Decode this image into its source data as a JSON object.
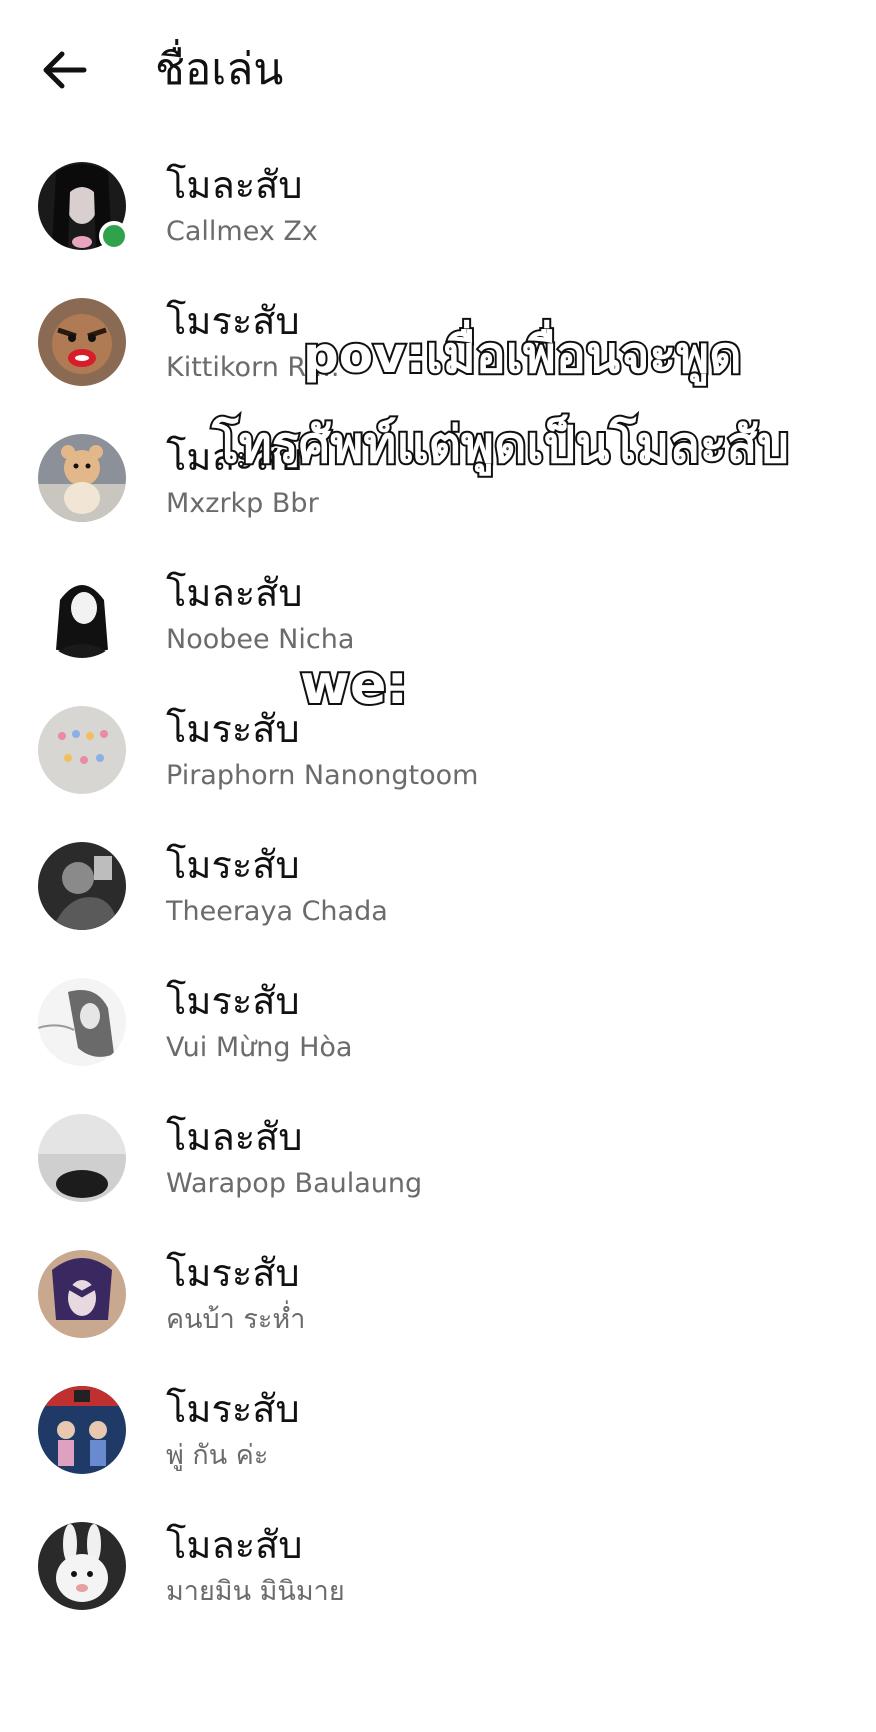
{
  "header": {
    "back_icon": "arrow-left-icon",
    "title": "ชื่อเล่น"
  },
  "members": [
    {
      "nickname": "โมละสับ",
      "name": "Callmex Zx",
      "online": true,
      "avatar": "dark-hair-girl"
    },
    {
      "nickname": "โมระสับ",
      "name": "Kittikorn Ri...",
      "online": false,
      "avatar": "monkey-face"
    },
    {
      "nickname": "โมละสับ",
      "name": "Mxzrkp Bbr",
      "online": false,
      "avatar": "teddy-bear"
    },
    {
      "nickname": "โมละสับ",
      "name": "Noobee Nicha",
      "online": false,
      "avatar": "anime-black-hair"
    },
    {
      "nickname": "โมระสับ",
      "name": "Piraphorn Nanongtoom",
      "online": false,
      "avatar": "figurines"
    },
    {
      "nickname": "โมระสับ",
      "name": "Theeraya Chada",
      "online": false,
      "avatar": "grey-photo"
    },
    {
      "nickname": "โมระสับ",
      "name": "Vui Mừng Hòa",
      "online": false,
      "avatar": "sketch-girl"
    },
    {
      "nickname": "โมละสับ",
      "name": "Warapop Baulaung",
      "online": false,
      "avatar": "grey-wall-hair"
    },
    {
      "nickname": "โมระสับ",
      "name": "คนบ้า ระห่ำ",
      "online": false,
      "avatar": "purple-anime"
    },
    {
      "nickname": "โมระสับ",
      "name": "พู่ กัน ค่ะ",
      "online": false,
      "avatar": "vs-poster"
    },
    {
      "nickname": "โมละสับ",
      "name": "มายมิน มินิมาย",
      "online": false,
      "avatar": "white-rabbit"
    }
  ],
  "overlay": {
    "line1": "pov:เมื่อเพื่อนจะพูด",
    "line2": "โทรศัพท์แต่พูดเป็นโมละสับ",
    "line3": "we:"
  },
  "colors": {
    "online": "#31a24c",
    "secondary_text": "#6b6b6b",
    "overlay_fill": "#ffffff",
    "overlay_stroke": "#111111"
  }
}
